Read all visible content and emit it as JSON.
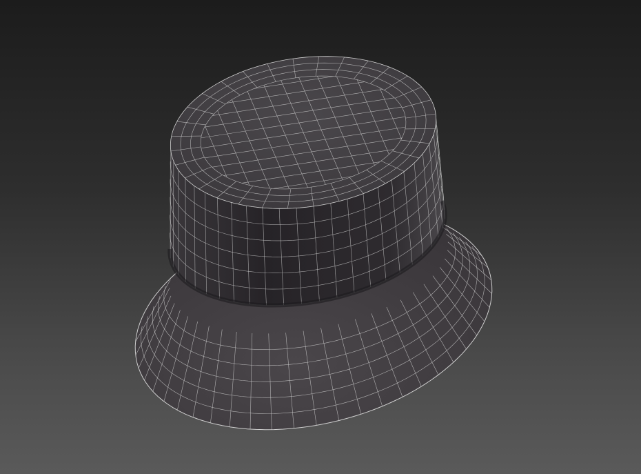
{
  "scene": {
    "object": "bucket-hat",
    "view": "perspective",
    "display_mode": "shaded-with-wireframe",
    "colors": {
      "surface": "#403c40",
      "surface_dark": "#2a272b",
      "wire": "#cfcfcf"
    }
  }
}
